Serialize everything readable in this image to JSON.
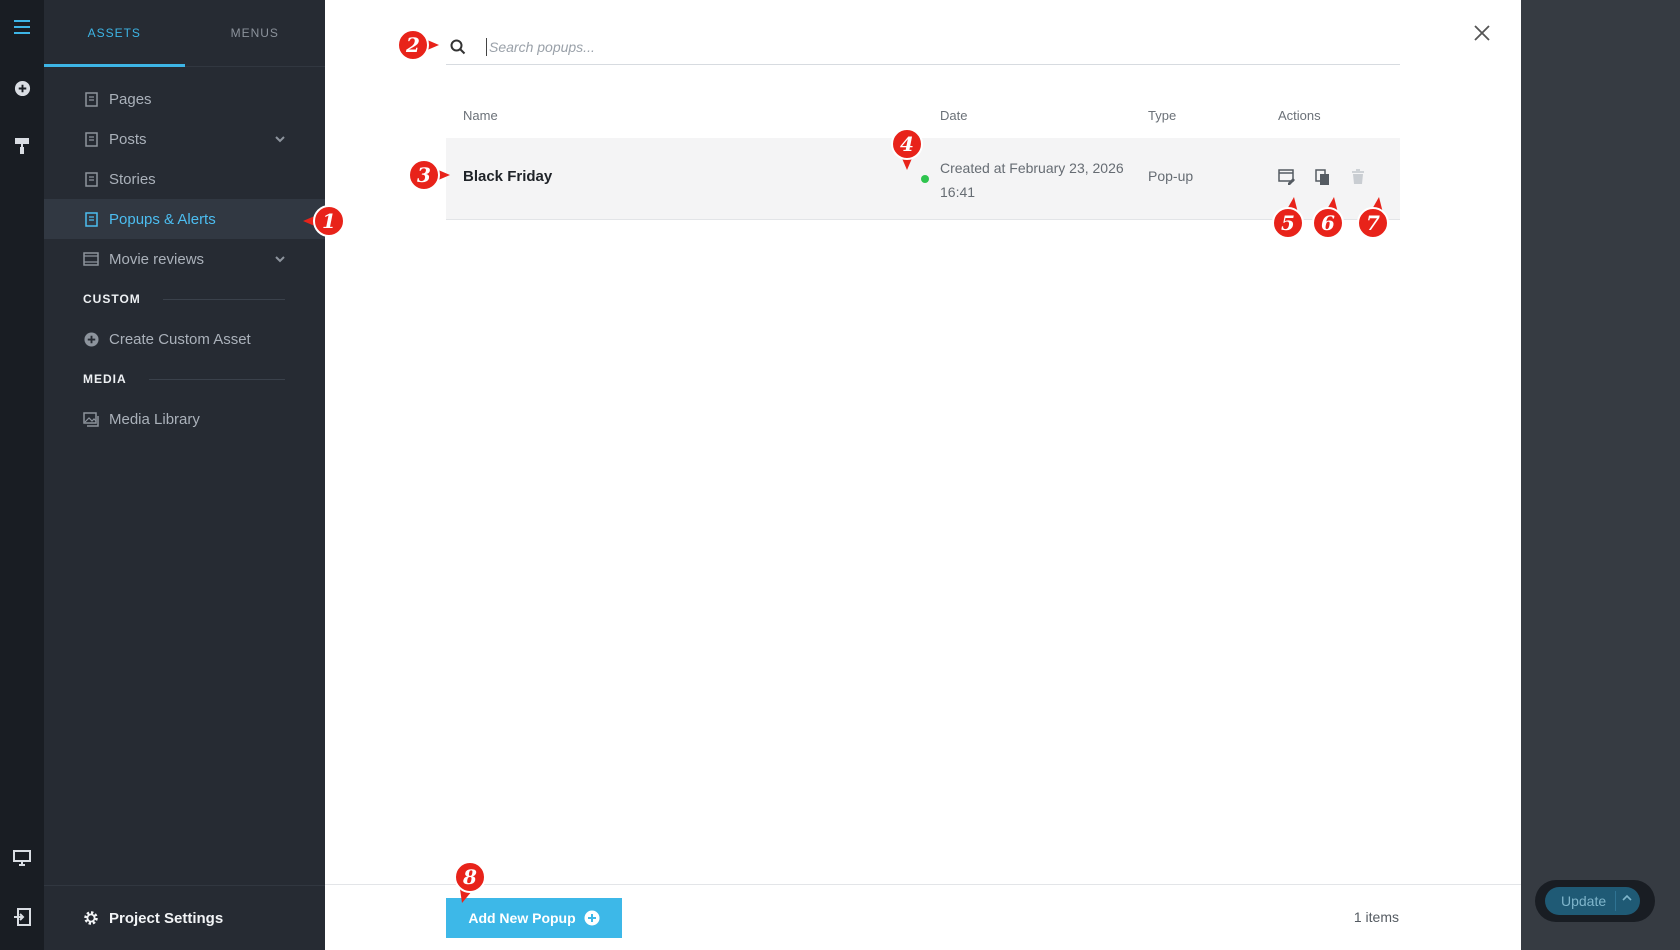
{
  "sidebar": {
    "tabs": [
      {
        "label": "ASSETS",
        "active": true
      },
      {
        "label": "MENUS",
        "active": false
      }
    ],
    "items": [
      {
        "label": "Pages",
        "icon": "page-icon"
      },
      {
        "label": "Posts",
        "icon": "page-icon",
        "expandable": true
      },
      {
        "label": "Stories",
        "icon": "page-icon"
      },
      {
        "label": "Popups & Alerts",
        "icon": "page-icon",
        "active": true
      },
      {
        "label": "Movie reviews",
        "icon": "film-icon",
        "expandable": true
      }
    ],
    "sections": {
      "custom": {
        "label": "CUSTOM",
        "item": "Create Custom Asset"
      },
      "media": {
        "label": "MEDIA",
        "item": "Media Library"
      }
    },
    "footer": {
      "label": "Project Settings"
    }
  },
  "search": {
    "placeholder": "Search popups..."
  },
  "table": {
    "headers": {
      "name": "Name",
      "date": "Date",
      "type": "Type",
      "actions": "Actions"
    },
    "rows": [
      {
        "name": "Black Friday",
        "status": "published",
        "status_color": "#2ec44e",
        "date_line1": "Created at February 23, 2026",
        "date_line2": "16:41",
        "type": "Pop-up",
        "actions": [
          "edit-icon",
          "duplicate-icon",
          "delete-icon"
        ]
      }
    ]
  },
  "footer": {
    "add_label": "Add New Popup",
    "count": "1 items"
  },
  "update": {
    "label": "Update"
  },
  "annotations": [
    "1",
    "2",
    "3",
    "4",
    "5",
    "6",
    "7",
    "8"
  ],
  "colors": {
    "accent": "#3db8e8",
    "badge": "#e8231a",
    "sidebar": "#262b33",
    "rail": "#191d23"
  }
}
